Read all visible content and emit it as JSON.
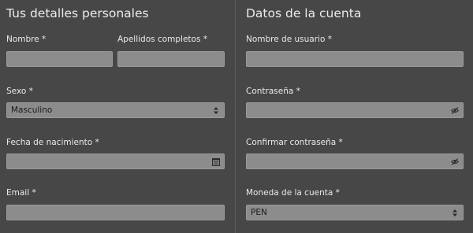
{
  "personal": {
    "title": "Tus detalles personales",
    "nombre_label": "Nombre *",
    "nombre_value": "",
    "apellidos_label": "Apellidos completos *",
    "apellidos_value": "",
    "sexo_label": "Sexo *",
    "sexo_value": "Masculino",
    "fecha_label": "Fecha de nacimiento *",
    "fecha_value": "",
    "email_label": "Email *",
    "email_value": ""
  },
  "account": {
    "title": "Datos de la cuenta",
    "usuario_label": "Nombre de usuario *",
    "usuario_value": "",
    "password_label": "Contraseña *",
    "password_value": "",
    "confirm_label": "Confirmar contraseña *",
    "confirm_value": "",
    "moneda_label": "Moneda de la cuenta *",
    "moneda_value": "PEN"
  },
  "icons": {
    "select_arrows": "select-arrows-icon",
    "calendar": "calendar-icon",
    "eye_hidden": "eye-slash-icon"
  },
  "colors": {
    "background": "#474747",
    "field": "#8c8c8c",
    "text": "#e9e9e9"
  }
}
